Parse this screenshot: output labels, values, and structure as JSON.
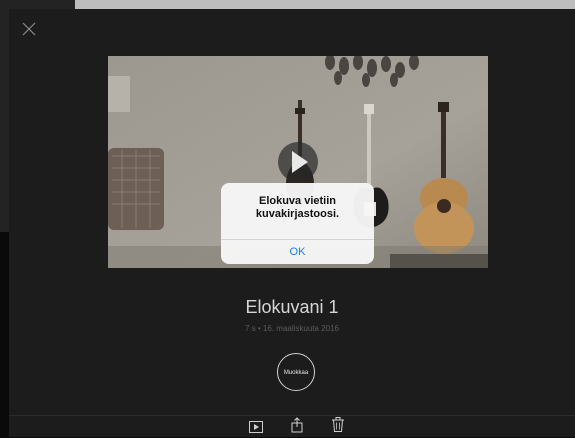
{
  "header": {
    "close_icon": "close-icon"
  },
  "alert": {
    "message_line1": "Elokuva vietiin",
    "message_line2": "kuvakirjastoosi.",
    "ok_label": "OK"
  },
  "movie": {
    "title": "Elokuvani 1",
    "meta": "7 s • 16. maaliskuuta 2016",
    "edit_label": "Muokkaa"
  },
  "toolbar": {
    "items": [
      {
        "icon": "play-icon"
      },
      {
        "icon": "share-icon"
      },
      {
        "icon": "trash-icon"
      }
    ]
  },
  "colors": {
    "background": "#1c1c1c",
    "alert_button": "#1a7cf5"
  }
}
